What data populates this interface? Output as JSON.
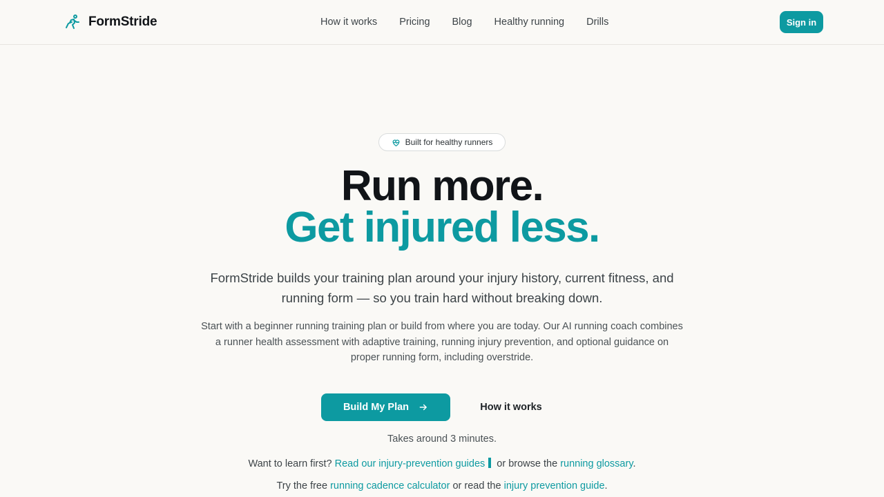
{
  "nav": {
    "brand": "FormStride",
    "links": [
      "How it works",
      "Pricing",
      "Blog",
      "Healthy running",
      "Drills"
    ],
    "sign_in": "Sign in"
  },
  "hero": {
    "badge": "Built for healthy runners",
    "headline_line1": "Run more.",
    "headline_line2": "Get injured less.",
    "lead": "FormStride builds your training plan around your injury history, current fitness, and running form — so you train hard without breaking down.",
    "sub": "Start with a beginner running training plan or build from where you are today. Our AI running coach combines a runner health assessment with adaptive training, running injury prevention, and optional guidance on proper running form, including overstride.",
    "cta_primary": "Build My Plan",
    "cta_secondary": "How it works",
    "duration": "Takes around 3 minutes."
  },
  "learn": {
    "prefix": "Want to learn first?",
    "guides_link": "Read our injury-prevention guides",
    "middle": "or browse the",
    "glossary_link": "running glossary",
    "suffix": "."
  },
  "tools": {
    "prefix": "Try the free",
    "calculator_link": "running cadence calculator",
    "middle": "or read the",
    "guide_link": "injury prevention guide",
    "suffix": "."
  },
  "icons": {
    "brand": "running-person-icon",
    "badge": "heart-pulse-icon",
    "cta": "arrow-right-icon"
  },
  "colors": {
    "accent": "#0d9aa1",
    "background": "#faf9f6",
    "heading": "#111418",
    "body_text": "#3c4347"
  }
}
